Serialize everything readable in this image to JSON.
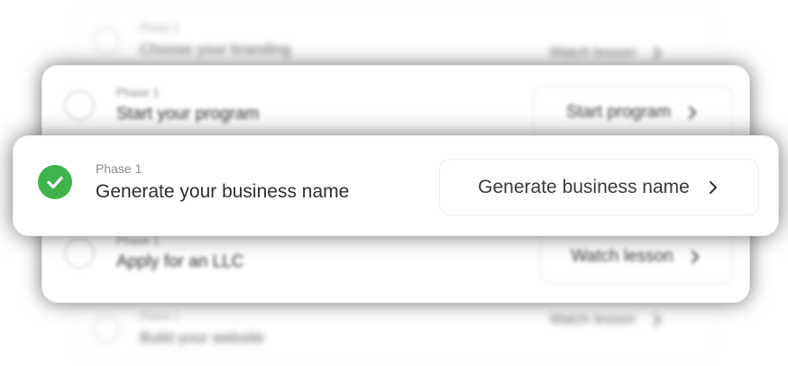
{
  "cards": {
    "back_top": {
      "phase": "Phase 1",
      "title": "Choose your branding",
      "action": "Watch lesson"
    },
    "mid_top": {
      "phase": "Phase 1",
      "title": "Start your program",
      "action": "Start program"
    },
    "active": {
      "phase": "Phase 1",
      "title": "Generate your business name",
      "action": "Generate business name",
      "status": "completed"
    },
    "mid_bottom": {
      "phase": "Phase 1",
      "title": "Apply for an LLC",
      "action": "Watch lesson"
    },
    "back_bottom": {
      "phase": "Phase 1",
      "title": "Build your website",
      "action": "Watch lesson"
    }
  },
  "colors": {
    "check_green": "#3fb44c",
    "text_dark": "#2f2f2f",
    "text_muted": "#8a8a8a"
  },
  "icons": {
    "done": "check-circle-icon",
    "pending": "radio-empty-icon",
    "next": "chevron-right-icon"
  }
}
